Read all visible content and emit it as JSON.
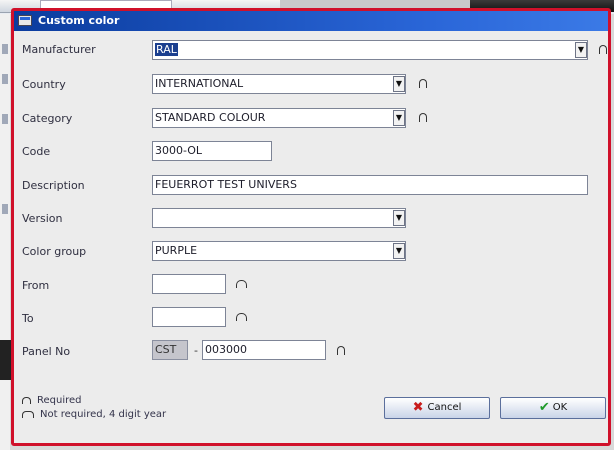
{
  "dialog": {
    "title": "Custom color"
  },
  "fields": {
    "manufacturer": {
      "label": "Manufacturer",
      "value": "RAL"
    },
    "country": {
      "label": "Country",
      "value": "INTERNATIONAL"
    },
    "category": {
      "label": "Category",
      "value": "STANDARD COLOUR"
    },
    "code": {
      "label": "Code",
      "value": "3000-OL"
    },
    "description": {
      "label": "Description",
      "value": "FEUERROT TEST UNIVERS"
    },
    "version": {
      "label": "Version",
      "value": ""
    },
    "color_group": {
      "label": "Color group",
      "value": "PURPLE"
    },
    "from": {
      "label": "From",
      "value": ""
    },
    "to": {
      "label": "To",
      "value": ""
    },
    "panel_no": {
      "label": "Panel No",
      "prefix": "CST",
      "separator": "-",
      "value": "003000"
    }
  },
  "legend": {
    "required": "Required",
    "not_required": "Not required, 4 digit year"
  },
  "buttons": {
    "cancel": "Cancel",
    "ok": "OK"
  },
  "colors": {
    "border_accent": "#d0102a",
    "titlebar": "#0b3c9e"
  }
}
